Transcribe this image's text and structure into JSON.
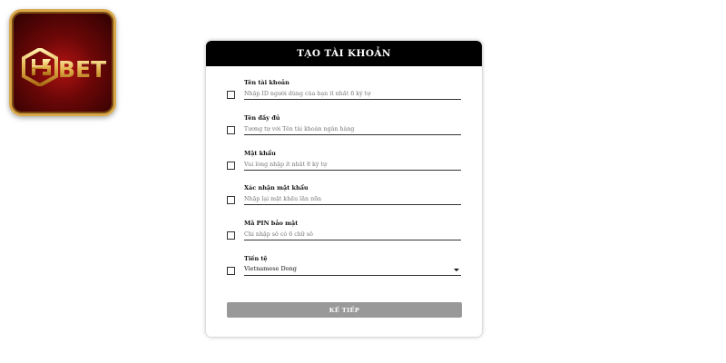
{
  "brand": {
    "logo_text": "H3BET",
    "accent": "#d9a84a",
    "background": "#8b0a0a"
  },
  "form": {
    "title": "TẠO TÀI KHOẢN",
    "fields": [
      {
        "label": "Tên tài khoản",
        "placeholder": "Nhập ID người dùng của bạn ít nhất 6 ký tự"
      },
      {
        "label": "Tên đầy đủ",
        "placeholder": "Tương tự với Tên tài khoản ngân hàng"
      },
      {
        "label": "Mật khẩu",
        "placeholder": "Vui lòng nhập ít nhất 8 ký tự"
      },
      {
        "label": "Xác nhận mật khẩu",
        "placeholder": "Nhập lại mật khẩu lần nữa"
      },
      {
        "label": "Mã PIN bảo mật",
        "placeholder": "Chỉ nhập số có 6 chữ số"
      }
    ],
    "currency": {
      "label": "Tiền tệ",
      "value": "Vietnamese Dong"
    },
    "submit_label": "KẾ TIẾP",
    "colors": {
      "header": "#000000",
      "button": "#999999"
    }
  }
}
